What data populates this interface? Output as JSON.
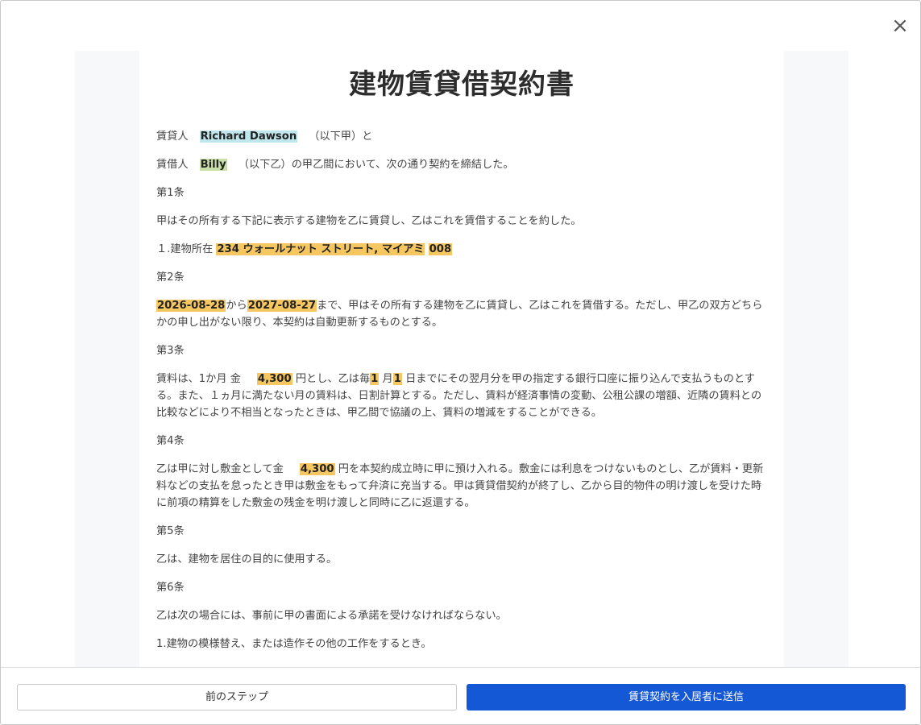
{
  "modal": {
    "close_label": "×",
    "footer": {
      "prev_label": "前のステップ",
      "send_label": "賃貸契約を入居者に送信"
    }
  },
  "document": {
    "title": "建物賃貸借契約書",
    "lessor_line": {
      "prefix": "賃貸人",
      "name": "Richard Dawson",
      "suffix": "（以下甲）と"
    },
    "lessee_line": {
      "prefix": "賃借人",
      "name": "Billy",
      "suffix": "（以下乙）の甲乙間において、次の通り契約を締結した。"
    },
    "article1": {
      "heading": "第1条",
      "text": "甲はその所有する下記に表示する建物を乙に賃貸し、乙はこれを賃借することを約した。",
      "item_prefix": "１.建物所在",
      "address": "234 ウォールナット ストリート, マイアミ",
      "unit": "008"
    },
    "article2": {
      "heading": "第2条",
      "start_date": "2026-08-28",
      "from": "から",
      "end_date": "2027-08-27",
      "text": "まで、甲はその所有する建物を乙に賃貸し、乙はこれを賃借する。ただし、甲乙の双方どちらかの申し出がない限り、本契約は自動更新するものとする。"
    },
    "article3": {
      "heading": "第3条",
      "pre": "賃料は、1か月 金",
      "rent": "4,300",
      "mid": "円とし、乙は毎",
      "month": "1",
      "mid2": "月",
      "day": "1",
      "post": "日までにその翌月分を甲の指定する銀行口座に振り込んで支払うものとする。また、１ヵ月に満たない月の賃料は、日割計算とする。ただし、賃料が経済事情の変動、公租公課の増額、近隣の賃料との比較などにより不相当となったときは、甲乙間で協議の上、賃料の増減をすることができる。"
    },
    "article4": {
      "heading": "第4条",
      "pre": "乙は甲に対し敷金として金",
      "deposit": "4,300",
      "post": "円を本契約成立時に甲に預け入れる。敷金には利息をつけないものとし、乙が賃料・更新料などの支払を怠ったとき甲は敷金をもって弁済に充当する。甲は賃貸借契約が終了し、乙から目的物件の明け渡しを受けた時に前項の精算をした敷金の残金を明け渡しと同時に乙に返還する。"
    },
    "article5": {
      "heading": "第5条",
      "text": "乙は、建物を居住の目的に使用する。"
    },
    "article6": {
      "heading": "第6条",
      "text": "乙は次の場合には、事前に甲の書面による承諾を受けなければならない。",
      "item1": "1.建物の模様替え、または造作その他の工作をするとき。"
    }
  },
  "colors": {
    "primary_button": "#1558d6",
    "highlight_lessor": "#bfe6ec",
    "highlight_lessee": "#c8e0a8",
    "highlight_field": "#f6c660"
  }
}
